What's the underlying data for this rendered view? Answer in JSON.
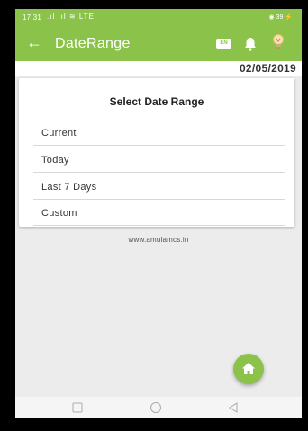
{
  "status_bar": {
    "time": "17:31",
    "signal": ".ıl .ıl ≋ LTE",
    "right": "◉ 39 ⚡"
  },
  "app_bar": {
    "back_icon": "arrow-left-icon",
    "title": "DateRange",
    "lang_badge": "EN",
    "bell_icon": "bell-icon",
    "bulb_icon": "lightbulb-icon"
  },
  "date_bar": {
    "date": "02/05/2019"
  },
  "dialog": {
    "heading": "Select Date Range",
    "options": [
      {
        "label": "Current"
      },
      {
        "label": "Today"
      },
      {
        "label": "Last 7 Days"
      },
      {
        "label": "Custom"
      }
    ]
  },
  "footer": {
    "url": "www.amulamcs.in"
  },
  "fab": {
    "icon": "home-icon"
  },
  "nav_bar": {
    "icons": [
      "recent-apps-icon",
      "home-circle-icon",
      "back-triangle-icon"
    ]
  },
  "colors": {
    "accent": "#8bc34a",
    "background": "#ececec"
  }
}
